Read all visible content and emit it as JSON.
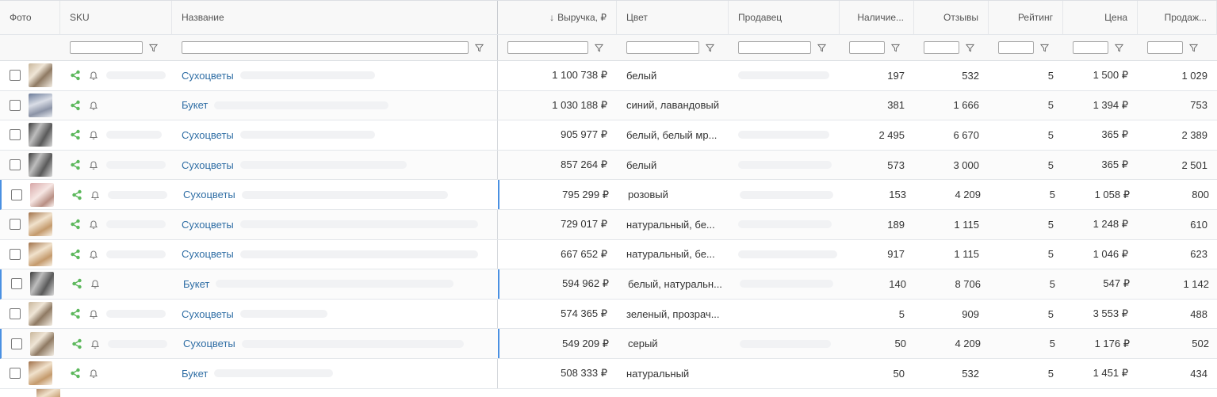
{
  "columns": {
    "photo": "Фото",
    "sku": "SKU",
    "name": "Название",
    "revenue": "Выручка, ₽",
    "revenue_sort": "↓",
    "color": "Цвет",
    "seller": "Продавец",
    "stock": "Наличие...",
    "reviews": "Отзывы",
    "rating": "Рейтинг",
    "price": "Цена",
    "sales": "Продаж..."
  },
  "colors": {
    "link": "#2e6da4",
    "share_icon": "#5cb85c",
    "focus": "#4a90e2"
  },
  "rows": [
    {
      "name": "Сухоцветы",
      "revenue": "1 100 738 ₽",
      "color": "белый",
      "stock": "197",
      "reviews": "532",
      "rating": "5",
      "price": "1 500 ₽",
      "sales": "1 029"
    },
    {
      "name": "Букет",
      "revenue": "1 030 188 ₽",
      "color": "синий, лавандовый",
      "stock": "381",
      "reviews": "1 666",
      "rating": "5",
      "price": "1 394 ₽",
      "sales": "753"
    },
    {
      "name": "Сухоцветы",
      "revenue": "905 977 ₽",
      "color": "белый, белый мр...",
      "stock": "2 495",
      "reviews": "6 670",
      "rating": "5",
      "price": "365 ₽",
      "sales": "2 389"
    },
    {
      "name": "Сухоцветы",
      "revenue": "857 264 ₽",
      "color": "белый",
      "stock": "573",
      "reviews": "3 000",
      "rating": "5",
      "price": "365 ₽",
      "sales": "2 501"
    },
    {
      "name": "Сухоцветы",
      "revenue": "795 299 ₽",
      "color": "розовый",
      "stock": "153",
      "reviews": "4 209",
      "rating": "5",
      "price": "1 058 ₽",
      "sales": "800"
    },
    {
      "name": "Сухоцветы",
      "revenue": "729 017 ₽",
      "color": "натуральный, бе...",
      "stock": "189",
      "reviews": "1 115",
      "rating": "5",
      "price": "1 248 ₽",
      "sales": "610"
    },
    {
      "name": "Сухоцветы",
      "revenue": "667 652 ₽",
      "color": "натуральный, бе...",
      "stock": "917",
      "reviews": "1 115",
      "rating": "5",
      "price": "1 046 ₽",
      "sales": "623"
    },
    {
      "name": "Букет",
      "revenue": "594 962 ₽",
      "color": "белый, натуральн...",
      "stock": "140",
      "reviews": "8 706",
      "rating": "5",
      "price": "547 ₽",
      "sales": "1 142"
    },
    {
      "name": "Сухоцветы",
      "revenue": "574 365 ₽",
      "color": "зеленый, прозрач...",
      "stock": "5",
      "reviews": "909",
      "rating": "5",
      "price": "3 553 ₽",
      "sales": "488"
    },
    {
      "name": "Сухоцветы",
      "revenue": "549 209 ₽",
      "color": "серый",
      "stock": "50",
      "reviews": "4 209",
      "rating": "5",
      "price": "1 176 ₽",
      "sales": "502"
    },
    {
      "name": "Букет",
      "revenue": "508 333 ₽",
      "color": "натуральный",
      "stock": "50",
      "reviews": "532",
      "rating": "5",
      "price": "1 451 ₽",
      "sales": "434"
    }
  ]
}
